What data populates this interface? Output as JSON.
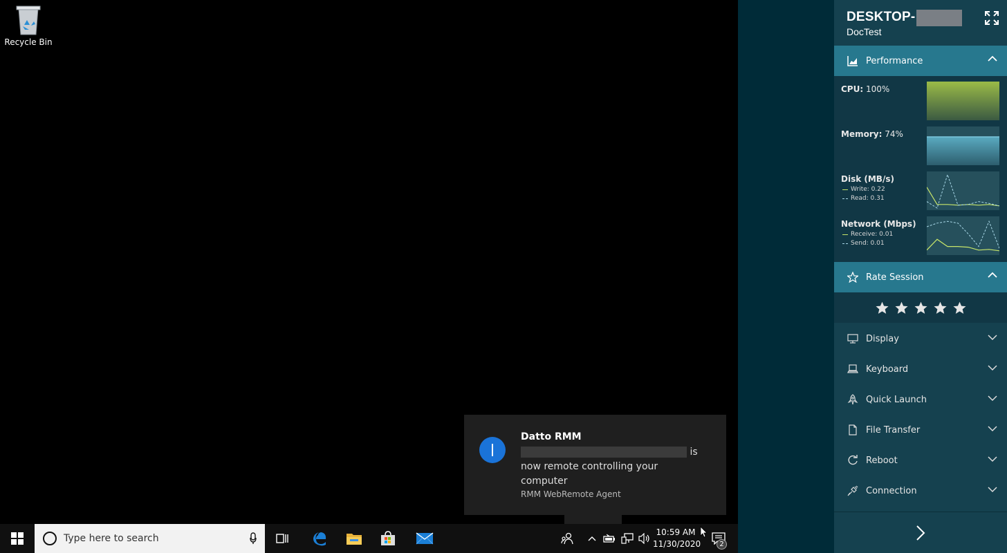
{
  "desktop": {
    "recycle_bin_label": "Recycle Bin"
  },
  "toast": {
    "title": "Datto RMM",
    "body_suffix": " is now remote controlling your computer",
    "source": "RMM WebRemote Agent"
  },
  "taskbar": {
    "search_placeholder": "Type here to search",
    "time": "10:59 AM",
    "date": "11/30/2020",
    "notification_count": "2",
    "pinned_icons": [
      "edge-icon",
      "file-explorer-icon",
      "store-icon",
      "mail-icon"
    ]
  },
  "panel": {
    "device_name_prefix": "DESKTOP-",
    "device_group": "DocTest",
    "performance": {
      "title": "Performance",
      "cpu": {
        "label": "CPU:",
        "value": "100%",
        "level": 1.0
      },
      "memory": {
        "label": "Memory:",
        "value": "74%",
        "level": 0.74
      },
      "disk": {
        "label": "Disk (MB/s)",
        "write_label": "Write: 0.22",
        "read_label": "Read: 0.31",
        "write_series": [
          0.6,
          0.12,
          0.12,
          0.1,
          0.12,
          0.1,
          0.12,
          0.08
        ],
        "read_series": [
          0.2,
          0.02,
          0.95,
          0.1,
          0.12,
          0.2,
          0.15,
          0.08
        ]
      },
      "network": {
        "label": "Network (Mbps)",
        "receive_label": "Receive: 0.01",
        "send_label": "Send: 0.01",
        "receive_series": [
          0.1,
          0.4,
          0.2,
          0.2,
          0.18,
          0.1,
          0.12,
          0.08
        ],
        "send_series": [
          0.75,
          0.85,
          0.9,
          0.85,
          0.55,
          0.2,
          0.9,
          0.15
        ]
      },
      "colors": {
        "cpu": "#8fb140",
        "memory": "#4e9fb5",
        "write": "#c8e66a",
        "read": "#a9d8e8"
      }
    },
    "rate_session": {
      "title": "Rate Session",
      "stars": 5
    },
    "menu": [
      {
        "label": "Display",
        "icon": "monitor-icon"
      },
      {
        "label": "Keyboard",
        "icon": "keyboard-icon"
      },
      {
        "label": "Quick Launch",
        "icon": "rocket-icon"
      },
      {
        "label": "File Transfer",
        "icon": "file-icon"
      },
      {
        "label": "Reboot",
        "icon": "reboot-icon"
      },
      {
        "label": "Connection",
        "icon": "plug-icon"
      }
    ],
    "accent": "#27788e"
  }
}
